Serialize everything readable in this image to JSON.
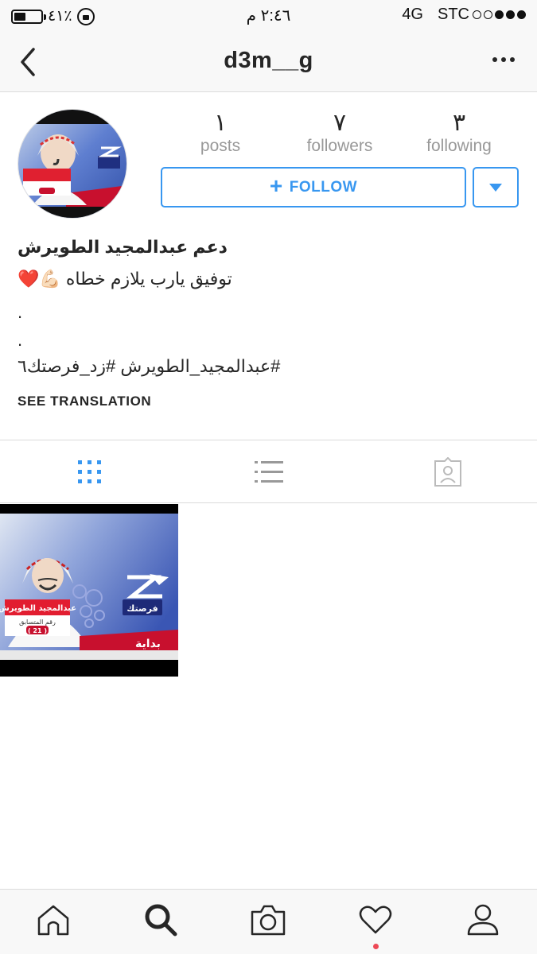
{
  "status_bar": {
    "battery_percent": "٤١٪",
    "time": "٢:٤٦ م",
    "network": "4G",
    "carrier": "STC",
    "signal_strength": 3,
    "signal_max": 5
  },
  "nav": {
    "title": "d3m__g"
  },
  "profile": {
    "stats": [
      {
        "value": "١",
        "label": "posts"
      },
      {
        "value": "٧",
        "label": "followers"
      },
      {
        "value": "٣",
        "label": "following"
      }
    ],
    "follow_label": "FOLLOW",
    "bio_name": "دعم عبدالمجيد الطويرش",
    "bio_line1": "توفيق يارب يلازم خطاه 💪🏻❤️",
    "bio_dot1": ".",
    "bio_dot2": ".",
    "bio_hashtags": "#عبدالمجيد_الطويرش #زد_فرصتك٦",
    "see_translation": "SEE TRANSLATION"
  },
  "post_image": {
    "name_text": "عبدالمجيد الطويرش",
    "contestant_label": "رقم المتسابق",
    "contestant_number": "( 21 )",
    "show_logo": "فرصتك",
    "channel_logo": "بداية"
  },
  "tabs": [
    {
      "name": "grid",
      "active": true
    },
    {
      "name": "list",
      "active": false
    },
    {
      "name": "tagged",
      "active": false
    }
  ],
  "bottom_bar": [
    "home",
    "search",
    "camera",
    "activity",
    "profile"
  ],
  "colors": {
    "accent": "#3897f0",
    "notification": "#ed4956",
    "text": "#262626",
    "muted": "#999999"
  }
}
